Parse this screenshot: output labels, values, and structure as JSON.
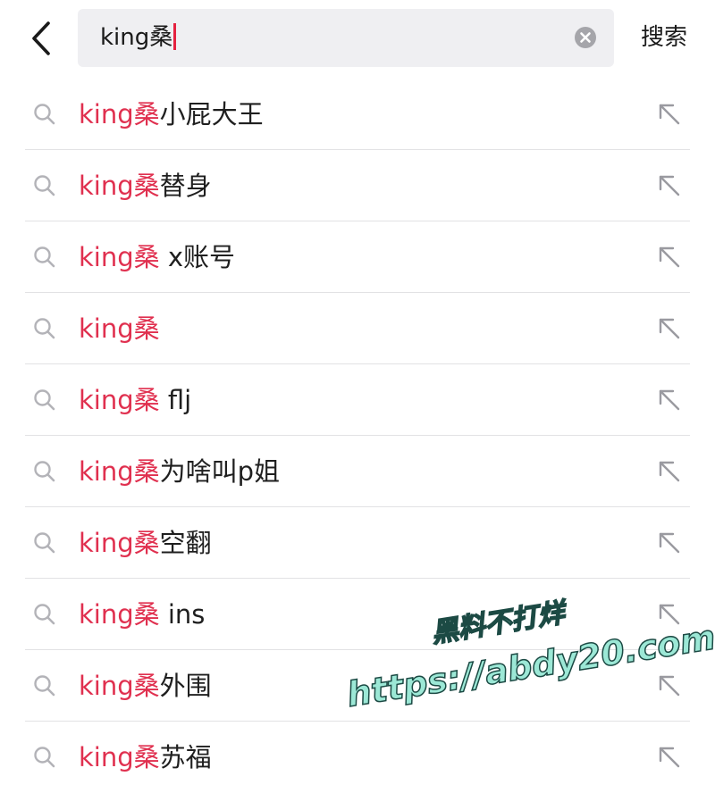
{
  "search": {
    "query": "king桑",
    "submit_label": "搜索"
  },
  "suggestions": [
    {
      "prefix": "king桑",
      "rest": "小屁大王"
    },
    {
      "prefix": "king桑",
      "rest": "替身"
    },
    {
      "prefix": "king桑",
      "rest": " x账号"
    },
    {
      "prefix": "king桑",
      "rest": ""
    },
    {
      "prefix": "king桑",
      "rest": " flj"
    },
    {
      "prefix": "king桑",
      "rest": "为啥叫p姐"
    },
    {
      "prefix": "king桑",
      "rest": "空翻"
    },
    {
      "prefix": "king桑",
      "rest": " ins"
    },
    {
      "prefix": "king桑",
      "rest": "外围"
    },
    {
      "prefix": "king桑",
      "rest": "苏福"
    }
  ],
  "watermark": {
    "line1": "黑料不打烊",
    "line2": "https://abdy20.com"
  },
  "colors": {
    "highlight": "#e0304f",
    "caret": "#e5213f",
    "search_bg": "#efeff2",
    "watermark_fill": "#9ce8d6"
  },
  "icons": {
    "back": "chevron-left-icon",
    "clear": "clear-circle-icon",
    "row_search": "search-icon",
    "fill_query": "arrow-up-left-icon"
  }
}
